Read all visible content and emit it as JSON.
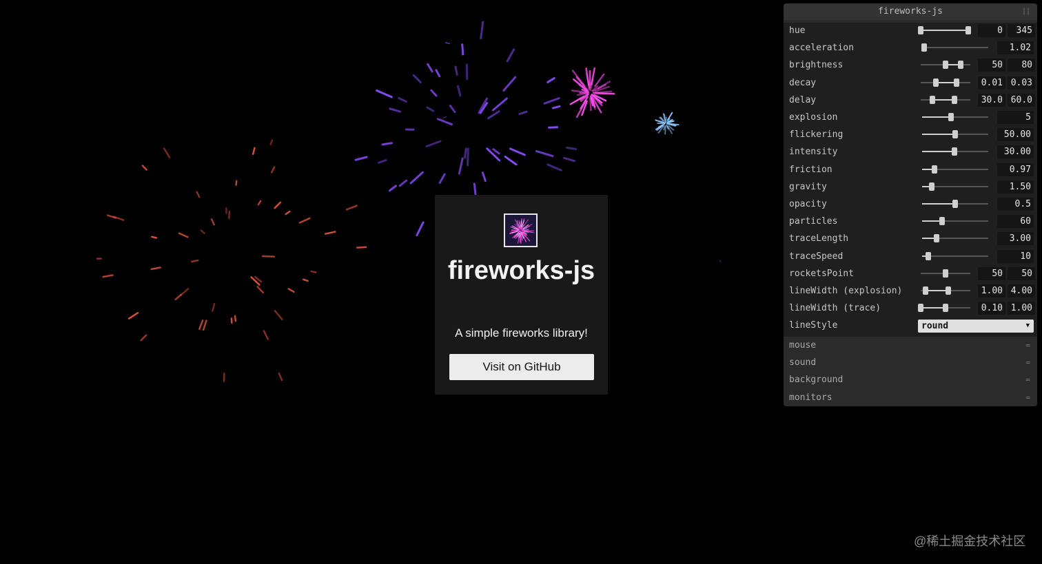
{
  "card": {
    "title": "fireworks-js",
    "subtitle": "A simple fireworks library!",
    "button": "Visit on GitHub"
  },
  "gui": {
    "title": "fireworks-js",
    "params": [
      {
        "label": "hue",
        "type": "range",
        "values": [
          "0",
          "345"
        ],
        "fraction": [
          0.0,
          0.96
        ]
      },
      {
        "label": "acceleration",
        "type": "single",
        "value": "1.02",
        "fraction": 0.03
      },
      {
        "label": "brightness",
        "type": "range",
        "values": [
          "50",
          "80"
        ],
        "fraction": [
          0.5,
          0.8
        ]
      },
      {
        "label": "decay",
        "type": "range",
        "values": [
          "0.01",
          "0.03"
        ],
        "fraction": [
          0.3,
          0.72
        ]
      },
      {
        "label": "delay",
        "type": "range",
        "values": [
          "30.0",
          "60.0"
        ],
        "fraction": [
          0.23,
          0.68
        ]
      },
      {
        "label": "explosion",
        "type": "single",
        "value": "5",
        "fraction": 0.44
      },
      {
        "label": "flickering",
        "type": "single",
        "value": "50.00",
        "fraction": 0.5
      },
      {
        "label": "intensity",
        "type": "single",
        "value": "30.00",
        "fraction": 0.49
      },
      {
        "label": "friction",
        "type": "single",
        "value": "0.97",
        "fraction": 0.19
      },
      {
        "label": "gravity",
        "type": "single",
        "value": "1.50",
        "fraction": 0.15
      },
      {
        "label": "opacity",
        "type": "single",
        "value": "0.5",
        "fraction": 0.5
      },
      {
        "label": "particles",
        "type": "single",
        "value": "60",
        "fraction": 0.3
      },
      {
        "label": "traceLength",
        "type": "single",
        "value": "3.00",
        "fraction": 0.22
      },
      {
        "label": "traceSpeed",
        "type": "single",
        "value": "10",
        "fraction": 0.09
      },
      {
        "label": "rocketsPoint",
        "type": "range",
        "values": [
          "50",
          "50"
        ],
        "fraction": [
          0.5,
          0.5
        ]
      },
      {
        "label": "lineWidth (explosion)",
        "type": "range",
        "values": [
          "1.00",
          "4.00"
        ],
        "fraction": [
          0.1,
          0.55
        ]
      },
      {
        "label": "lineWidth (trace)",
        "type": "range",
        "values": [
          "0.10",
          "1.00"
        ],
        "fraction": [
          0.0,
          0.5
        ]
      },
      {
        "label": "lineStyle",
        "type": "select",
        "value": "round"
      }
    ],
    "folders": [
      "mouse",
      "sound",
      "background",
      "monitors"
    ]
  },
  "watermark": "@稀土掘金技术社区",
  "colors": {
    "background": "#000000",
    "card": "#191919",
    "panel": "#2b2b2b",
    "burst_purple": "#8a4dff",
    "burst_pink": "#ff4df0",
    "burst_blue": "#8ec9ff",
    "burst_red": "#d9523a"
  },
  "icons": {
    "select_arrow": "chevron-down-icon",
    "folder_toggle": "folder-collapsed-icon",
    "panel_handle": "drag-handle-icon"
  }
}
